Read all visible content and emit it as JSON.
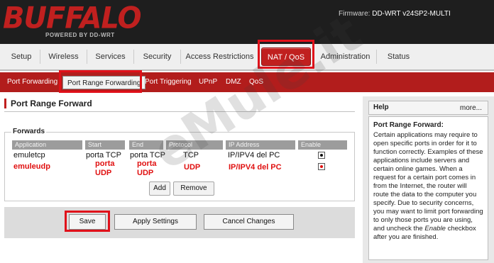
{
  "header": {
    "logo": "BUFFALO",
    "tagline": "POWERED BY DD-WRT",
    "firmware_label": "Firmware:",
    "firmware_value": "DD-WRT v24SP2-MULTI"
  },
  "main_tabs": [
    "Setup",
    "Wireless",
    "Services",
    "Security",
    "Access Restrictions",
    "NAT / QoS",
    "Administration",
    "Status"
  ],
  "sub_tabs": [
    "Port Forwarding",
    "Port Range Forwarding",
    "Port Triggering",
    "UPnP",
    "DMZ",
    "QoS"
  ],
  "page_title": "Port Range Forward",
  "forwards": {
    "legend": "Forwards",
    "columns": [
      "Application",
      "Start",
      "End",
      "Protocol",
      "IP Address",
      "Enable"
    ],
    "rows": [
      {
        "application": "emuletcp",
        "start": "porta TCP",
        "end": "porta TCP",
        "protocol": "TCP",
        "ip": "IP/IPV4 del PC"
      }
    ],
    "annotation_row": {
      "application": "emuleudp",
      "start_1": "porta",
      "start_2": "UDP",
      "end_1": "porta",
      "end_2": "UDP",
      "protocol": "UDP",
      "ip": "IP/IPV4 del PC"
    },
    "add_label": "Add",
    "remove_label": "Remove"
  },
  "footer": {
    "save_label": "Save",
    "apply_label": "Apply Settings",
    "cancel_label": "Cancel Changes"
  },
  "help": {
    "title": "Help",
    "more": "more...",
    "subtitle": "Port Range Forward:",
    "text_a": "Certain applications may require to open specific ports in order for it to function correctly. Examples of these applications include servers and certain online games. When a request for a certain port comes in from the Internet, the router will route the data to the computer you specify. Due to security concerns, you may want to limit port forwarding to only those ports you are using, and uncheck the ",
    "text_em": "Enable",
    "text_b": " checkbox after you are finished."
  },
  "watermark": "eMule.it",
  "colors": {
    "brand_red": "#c0201f",
    "highlight": "#e0101a",
    "annotation_red": "#e01010"
  }
}
